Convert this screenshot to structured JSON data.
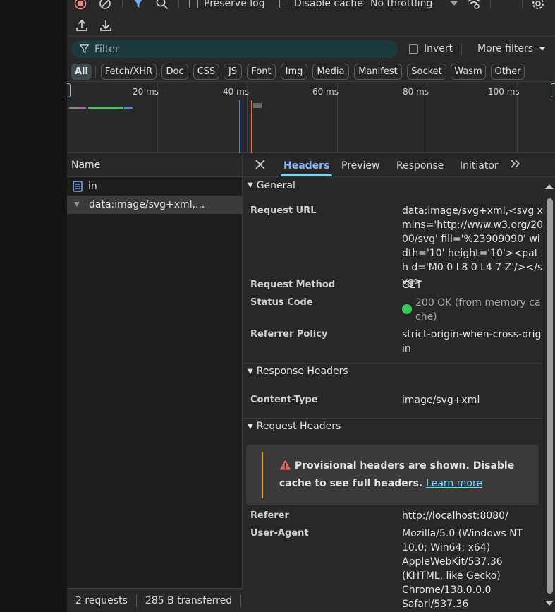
{
  "toolbar": {
    "preserve_log": "Preserve log",
    "disable_cache": "Disable cache",
    "throttling": "No throttling"
  },
  "filter": {
    "placeholder": "Filter",
    "invert": "Invert",
    "more_filters": "More filters"
  },
  "type_filters": [
    "All",
    "Fetch/XHR",
    "Doc",
    "CSS",
    "JS",
    "Font",
    "Img",
    "Media",
    "Manifest",
    "Socket",
    "Wasm",
    "Other"
  ],
  "timeline": {
    "ticks": [
      "20 ms",
      "40 ms",
      "60 ms",
      "80 ms",
      "100 ms"
    ]
  },
  "requests": {
    "column": "Name",
    "items": [
      "in",
      "data:image/svg+xml,..."
    ]
  },
  "status": {
    "requests": "2 requests",
    "transferred": "285 B transferred",
    "resources": "2"
  },
  "details": {
    "tabs": [
      "Headers",
      "Preview",
      "Response",
      "Initiator"
    ],
    "general": {
      "title": "General",
      "request_url_label": "Request URL",
      "request_url": "data:image/svg+xml,<svg xmlns='http://www.w3.org/2000/svg' fill='%23909090' width='10' height='10'><path d='M0 0 L8 0 L4 7 Z'/></svg>",
      "method_label": "Request Method",
      "method": "GET",
      "status_label": "Status Code",
      "status": "200 OK (from memory cache)",
      "referrer_label": "Referrer Policy",
      "referrer": "strict-origin-when-cross-origin"
    },
    "response_headers": {
      "title": "Response Headers",
      "content_type_label": "Content-Type",
      "content_type": "image/svg+xml"
    },
    "request_headers": {
      "title": "Request Headers",
      "warning": "Provisional headers are shown. Disable cache to see full headers.",
      "learn_more": "Learn more",
      "referer_label": "Referer",
      "referer": "http://localhost:8080/",
      "ua_label": "User-Agent",
      "ua": "Mozilla/5.0 (Windows NT 10.0; Win64; x64) AppleWebKit/537.36 (KHTML, like Gecko) Chrome/138.0.0.0 Safari/537.36"
    }
  },
  "colors": {
    "accent": "#7cd4fd",
    "success": "#34c759",
    "warning": "#e9a23b"
  }
}
